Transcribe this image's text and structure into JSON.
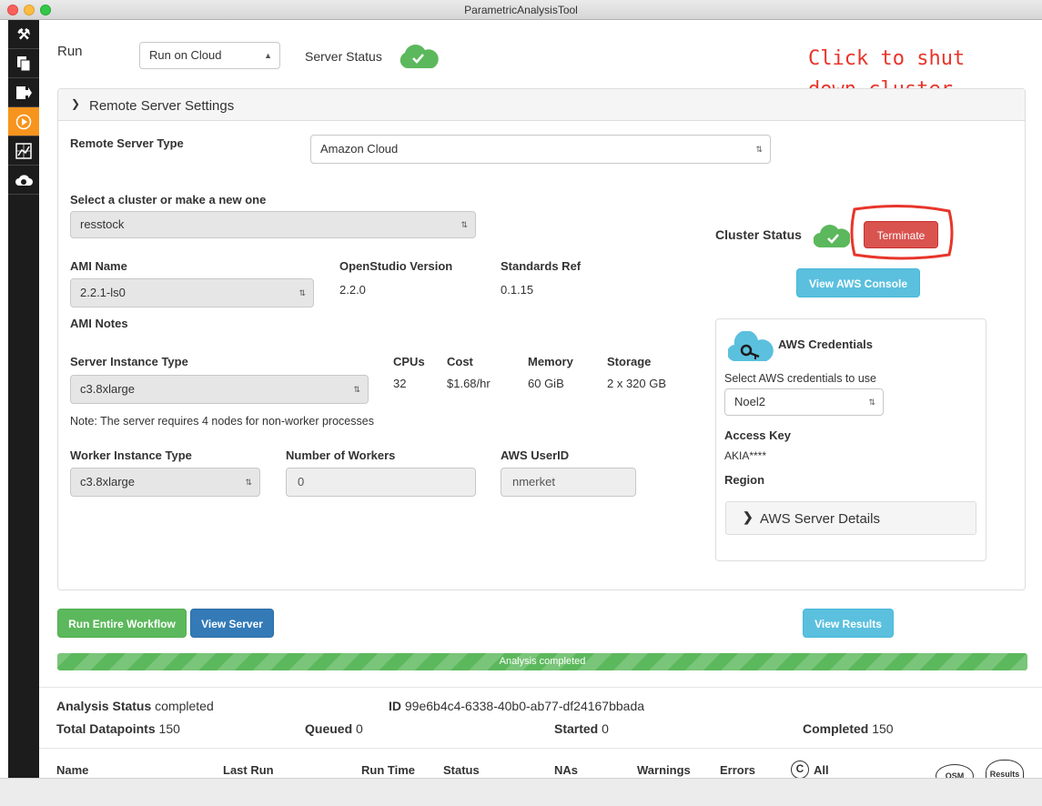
{
  "window": {
    "title": "ParametricAnalysisTool"
  },
  "run": {
    "label": "Run",
    "mode": "Run on Cloud",
    "server_status_label": "Server Status"
  },
  "annotation": {
    "line1": "Click to shut",
    "line2": "down cluster"
  },
  "remote": {
    "header": "Remote Server Settings",
    "server_type_label": "Remote Server Type",
    "server_type_value": "Amazon Cloud",
    "cluster_label": "Select a cluster or make a new one",
    "cluster_value": "resstock",
    "ami_name_label": "AMI Name",
    "ami_name_value": "2.2.1-ls0",
    "os_version_label": "OpenStudio Version",
    "os_version_value": "2.2.0",
    "standards_label": "Standards Ref",
    "standards_value": "0.1.15",
    "ami_notes_label": "AMI Notes",
    "server_instance_label": "Server Instance Type",
    "server_instance_value": "c3.8xlarge",
    "cpus_label": "CPUs",
    "cpus_value": "32",
    "cost_label": "Cost",
    "cost_value": "$1.68/hr",
    "memory_label": "Memory",
    "memory_value": "60 GiB",
    "storage_label": "Storage",
    "storage_value": "2 x 320 GB",
    "note": "Note: The server requires 4 nodes for non-worker processes",
    "worker_type_label": "Worker Instance Type",
    "worker_type_value": "c3.8xlarge",
    "num_workers_label": "Number of Workers",
    "num_workers_value": "0",
    "userid_label": "AWS UserID",
    "userid_value": "nmerket"
  },
  "cluster": {
    "status_label": "Cluster Status",
    "terminate": "Terminate",
    "view_console": "View AWS Console"
  },
  "credentials": {
    "title": "AWS Credentials",
    "select_label": "Select AWS credentials to use",
    "select_value": "Noel2",
    "access_key_label": "Access Key",
    "access_key_value": "AKIA****",
    "region_label": "Region",
    "details": "AWS Server Details"
  },
  "actions": {
    "run_workflow": "Run Entire Workflow",
    "view_server": "View Server",
    "view_results": "View Results"
  },
  "progress": {
    "text": "Analysis completed",
    "fraction": 1.0
  },
  "analysis": {
    "status_label": "Analysis Status",
    "status_value": "completed",
    "id_label": "ID",
    "id_value": "99e6b4c4-6338-40b0-ab77-df24167bbada",
    "total_label": "Total Datapoints",
    "total_value": "150",
    "queued_label": "Queued",
    "queued_value": "0",
    "started_label": "Started",
    "started_value": "0",
    "completed_label": "Completed",
    "completed_value": "150"
  },
  "table": {
    "columns": [
      "Name",
      "Last Run",
      "Run Time",
      "Status",
      "NAs",
      "Warnings",
      "Errors"
    ],
    "clear_icon": "C",
    "all_label": "All",
    "osm_label": "OSM",
    "results_label": "Results"
  },
  "colors": {
    "green": "#5cb85c",
    "blue": "#337ab7",
    "info": "#5bc0de",
    "red": "#d9534f",
    "orange": "#f7941d"
  }
}
